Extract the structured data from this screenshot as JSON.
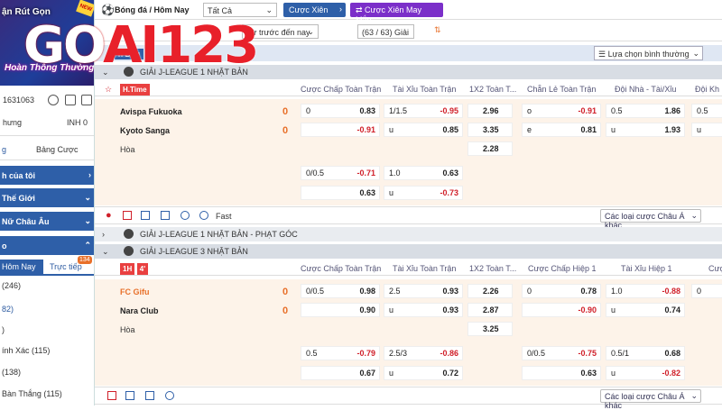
{
  "sidebar": {
    "promo_text": "ận Rút Gọn",
    "promo_new": "NEW",
    "promo_thong": "Hoàn Thông Thường",
    "account_id": "1631063",
    "account_label": "hưng",
    "inh_label": "INH 0",
    "tab_sports": "g",
    "tab_bet": "Bảng Cược",
    "menu": [
      {
        "label": "h của tôi"
      },
      {
        "label": " Thế Giới"
      },
      {
        "label": " Nữ Châu Âu"
      },
      {
        "label": "o"
      }
    ],
    "sub_today": "Hôm Nay",
    "sub_live": "Trực tiếp",
    "sub_live_count": "134",
    "items": [
      {
        "label": "  (246)"
      },
      {
        "label": "82)"
      },
      {
        "label": ")"
      },
      {
        "label": "ính Xác (115)"
      },
      {
        "label": "(138)"
      },
      {
        "label": " Bàn Thắng (115)"
      }
    ],
    "logo_a": "GO",
    "logo_b": "AI",
    "logo_c": "123"
  },
  "topbar": {
    "sport": "Bóng đá / Hôm Nay",
    "filter": "Tất Cả",
    "btn_combo": "Cược Xiên",
    "btn_lucky": "Cược Xiên May Mắn"
  },
  "bar2": {
    "date_filter": "Từ trước đến nay",
    "count": "(63 / 63) Giải"
  },
  "bar3": {
    "tab_label": "n Đấu",
    "sort": "Lựa chọn bình thường"
  },
  "leagues": [
    {
      "name": "GIẢI J-LEAGUE 1 NHẬT BẢN"
    },
    {
      "name": "GIẢI J-LEAGUE 1 NHẬT BẢN - PHẠT GÓC"
    },
    {
      "name": "GIẢI J-LEAGUE 3 NHẬT BẢN"
    }
  ],
  "columns": [
    "Cược Chấp Toàn Trận",
    "Tài Xỉu Toàn Trận",
    "1X2 Toàn T...",
    "Chẵn Lẻ Toàn Trận",
    "Đội Nhà - Tài/Xỉu",
    "Đội Kh"
  ],
  "columns2": [
    "Cược Chấp Toàn Trận",
    "Tài Xỉu Toàn Trận",
    "1X2 Toàn T...",
    "Cược Chấp Hiệp 1",
    "Tài Xỉu Hiệp 1",
    "Cượ"
  ],
  "match1": {
    "status": "H.Time",
    "home": "Avispa Fukuoka",
    "away": "Kyoto Sanga",
    "draw": "Hòa",
    "home_score": "0",
    "away_score": "0",
    "r1": [
      "0",
      "0.83",
      "1/1.5",
      "-0.95",
      "2.96",
      "o",
      "-0.91",
      "0.5",
      "1.86",
      "0.5"
    ],
    "r2": [
      "-0.91",
      "u",
      "0.85",
      "3.35",
      "e",
      "0.81",
      "u",
      "1.93",
      "u"
    ],
    "r3": [
      "2.28"
    ],
    "r4": [
      "0/0.5",
      "-0.71",
      "1.0",
      "0.63"
    ],
    "r5": [
      "0.63",
      "u",
      "-0.73"
    ]
  },
  "match2": {
    "status": "1H",
    "minute": "4'",
    "home": "FC Gifu",
    "away": "Nara Club",
    "draw": "Hòa",
    "home_score": "0",
    "away_score": "0",
    "r1": [
      "0/0.5",
      "0.98",
      "2.5",
      "0.93",
      "2.26",
      "0",
      "0.78",
      "1.0",
      "-0.88",
      "0"
    ],
    "r2": [
      "0.90",
      "u",
      "0.93",
      "2.87",
      "-0.90",
      "u",
      "0.74"
    ],
    "r3": [
      "3.25"
    ],
    "r4": [
      "0.5",
      "-0.79",
      "2.5/3",
      "-0.86",
      "0/0.5",
      "-0.75",
      "0.5/1",
      "0.68"
    ],
    "r5": [
      "0.67",
      "u",
      "0.72",
      "0.63",
      "u",
      "-0.82"
    ]
  },
  "toolbar": {
    "fast": "Fast",
    "other": "Các loại cược Châu Á khác"
  }
}
